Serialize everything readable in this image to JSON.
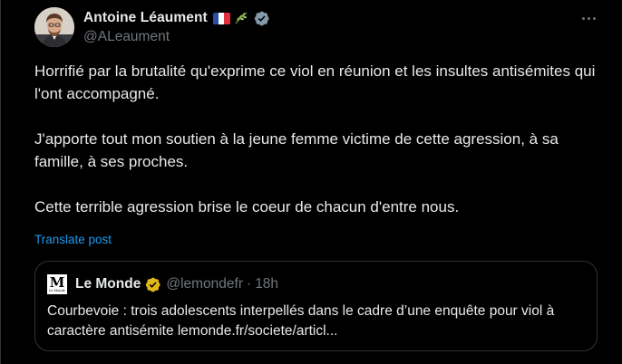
{
  "tweet": {
    "author": {
      "display_name": "Antoine Léaument",
      "handle": "@ALeaument",
      "emoji_icons": [
        "french-flag-icon",
        "leaf-icon"
      ],
      "verified_badge": "verified-badge-icon",
      "badge_color": "#829aab"
    },
    "more_icon": "more-options-icon",
    "text_paragraphs": [
      "Horrifié par la brutalité qu'exprime ce viol en réunion et les insultes antisémites qui l'ont accompagné.",
      "J'apporte tout mon soutien à la jeune femme victime de cette agression, à sa famille, à ses proches.",
      "Cette terrible agression brise le coeur de chacun d'entre nous."
    ],
    "translate_label": "Translate post"
  },
  "quote": {
    "avatar_glyph": "M",
    "avatar_sublabel": "Le Monde",
    "display_name": "Le Monde",
    "handle": "@lemondefr",
    "separator": "·",
    "time": "18h",
    "badge_color": "#e2b719",
    "text": "Courbevoie : trois adolescents interpellés dans le cadre d’une enquête pour viol à caractère antisémite lemonde.fr/societe/articl..."
  },
  "colors": {
    "background": "#000000",
    "text_primary": "#e7e9ea",
    "text_secondary": "#71767b",
    "link": "#1d9bf0",
    "border": "#2f3336"
  }
}
